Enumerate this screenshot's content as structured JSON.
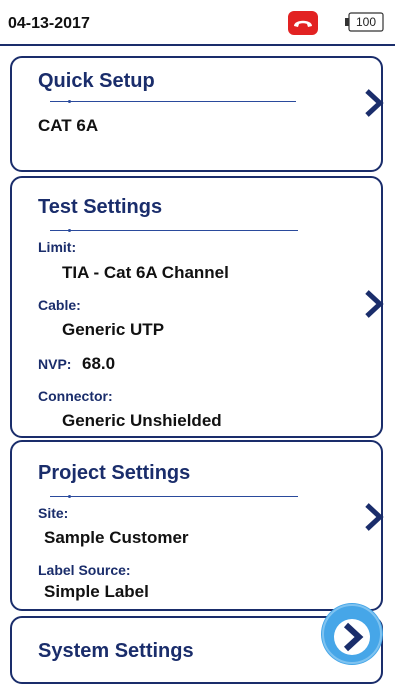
{
  "status_bar": {
    "date": "04-13-2017",
    "phone_icon": "phone-hangup-icon",
    "phone_color": "#e22222",
    "battery_level": "100"
  },
  "quick_setup": {
    "title": "Quick Setup",
    "value": "CAT 6A"
  },
  "test_settings": {
    "title": "Test Settings",
    "limit_label": "Limit:",
    "limit_value": "TIA - Cat 6A Channel",
    "cable_label": "Cable:",
    "cable_value": "Generic UTP",
    "nvp_label": "NVP:",
    "nvp_value": "68.0",
    "connector_label": "Connector:",
    "connector_value": "Generic Unshielded"
  },
  "project_settings": {
    "title": "Project Settings",
    "site_label": "Site:",
    "site_value": "Sample Customer",
    "label_source_label": "Label Source:",
    "label_source_value": "Simple Label"
  },
  "system_settings": {
    "title": "System Settings"
  },
  "colors": {
    "accent": "#1a2d6b",
    "highlight": "#46a6e8"
  }
}
